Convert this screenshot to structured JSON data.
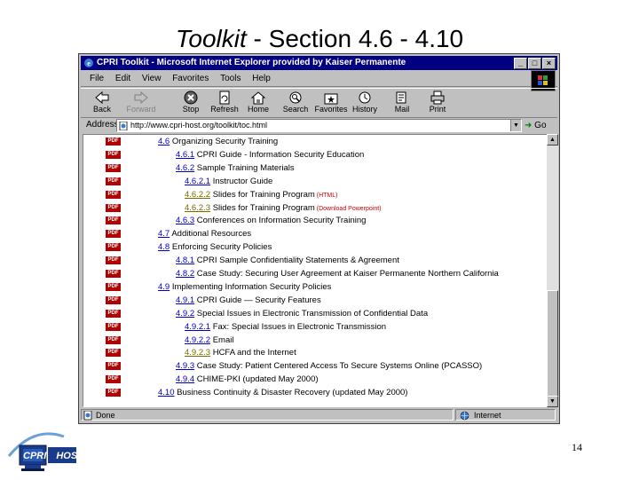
{
  "slide": {
    "title_italic": "Toolkit",
    "title_rest": " - Section 4.6 - 4.10",
    "page_number": "14",
    "logo_text": "CPRI HOST"
  },
  "browser": {
    "title": "CPRI Toolkit - Microsoft Internet Explorer provided by Kaiser Permanente",
    "window_buttons": [
      "_",
      "□",
      "×"
    ],
    "menu": [
      "File",
      "Edit",
      "View",
      "Favorites",
      "Tools",
      "Help"
    ],
    "toolbar": [
      {
        "label": "Back",
        "icon": "back-icon",
        "disabled": false
      },
      {
        "label": "Forward",
        "icon": "forward-icon",
        "disabled": true
      },
      {
        "label": "Stop",
        "icon": "stop-icon",
        "disabled": false
      },
      {
        "label": "Refresh",
        "icon": "refresh-icon",
        "disabled": false
      },
      {
        "label": "Home",
        "icon": "home-icon",
        "disabled": false
      },
      {
        "label": "Search",
        "icon": "search-icon",
        "disabled": false
      },
      {
        "label": "Favorites",
        "icon": "favorites-icon",
        "disabled": false
      },
      {
        "label": "History",
        "icon": "history-icon",
        "disabled": false
      },
      {
        "label": "Mail",
        "icon": "mail-icon",
        "disabled": false
      },
      {
        "label": "Print",
        "icon": "print-icon",
        "disabled": false
      }
    ],
    "address_label": "Address",
    "address_value": "http://www.cpri-host.org/toolkit/toc.html",
    "go_label": "Go",
    "status_left": "Done",
    "status_zone": "Internet"
  },
  "toc": [
    {
      "pdf": true,
      "num": "4.6",
      "title": " Organizing Security Training",
      "level": 0
    },
    {
      "pdf": true,
      "num": "4.6.1",
      "title": " CPRI Guide - Information Security Education",
      "level": 1
    },
    {
      "pdf": true,
      "num": "4.6.2",
      "title": " Sample Training Materials",
      "level": 1
    },
    {
      "pdf": true,
      "num": "4.6.2.1",
      "title": " Instructor Guide",
      "level": 2
    },
    {
      "pdf": true,
      "num": "4.6.2.2",
      "title": " Slides for Training Program",
      "note": " (HTML)",
      "level": 2,
      "visited": true
    },
    {
      "pdf": true,
      "num": "4.6.2.3",
      "title": " Slides for Training Program",
      "note": " (Download Powerpoint)",
      "level": 2,
      "visited": true
    },
    {
      "pdf": true,
      "num": "4.6.3",
      "title": " Conferences on Information Security Training",
      "level": 1
    },
    {
      "pdf": true,
      "num": "4.7",
      "title": " Additional Resources",
      "level": 0
    },
    {
      "pdf": true,
      "num": "4.8",
      "title": " Enforcing Security Policies",
      "level": 0
    },
    {
      "pdf": true,
      "num": "4.8.1",
      "title": " CPRI Sample Confidentiality Statements & Agreement",
      "level": 1
    },
    {
      "pdf": true,
      "num": "4.8.2",
      "title": " Case Study: Securing User Agreement at Kaiser Permanente Northern California",
      "level": 1
    },
    {
      "pdf": true,
      "num": "4.9",
      "title": " Implementing Information Security Policies",
      "level": 0
    },
    {
      "pdf": true,
      "num": "4.9.1",
      "title": " CPRI Guide — Security Features",
      "level": 1
    },
    {
      "pdf": true,
      "num": "4.9.2",
      "title": " Special Issues in Electronic Transmission of Confidential Data",
      "level": 1
    },
    {
      "pdf": true,
      "num": "4.9.2.1",
      "title": " Fax: Special Issues in Electronic Transmission",
      "level": 2
    },
    {
      "pdf": true,
      "num": "4.9.2.2",
      "title": " Email",
      "level": 2
    },
    {
      "pdf": true,
      "num": "4.9.2.3",
      "title": " HCFA and the Internet",
      "level": 2,
      "visited": true
    },
    {
      "pdf": true,
      "num": "4.9.3",
      "title": " Case Study: Patient Centered Access To Secure Systems Online (PCASSO)",
      "level": 1
    },
    {
      "pdf": true,
      "num": "4.9.4",
      "title": " CHIME-PKI (updated May 2000)",
      "level": 1
    },
    {
      "pdf": true,
      "num": "4.10",
      "title": " Business Continuity & Disaster Recovery (updated May 2000)",
      "level": 0
    }
  ],
  "pdf_label": "PDF",
  "colors": {
    "title_bar": "#000080",
    "link": "#0000cc",
    "visited_link": "#7a6a00",
    "pdf_badge": "#b00000",
    "note": "#cc0000"
  }
}
